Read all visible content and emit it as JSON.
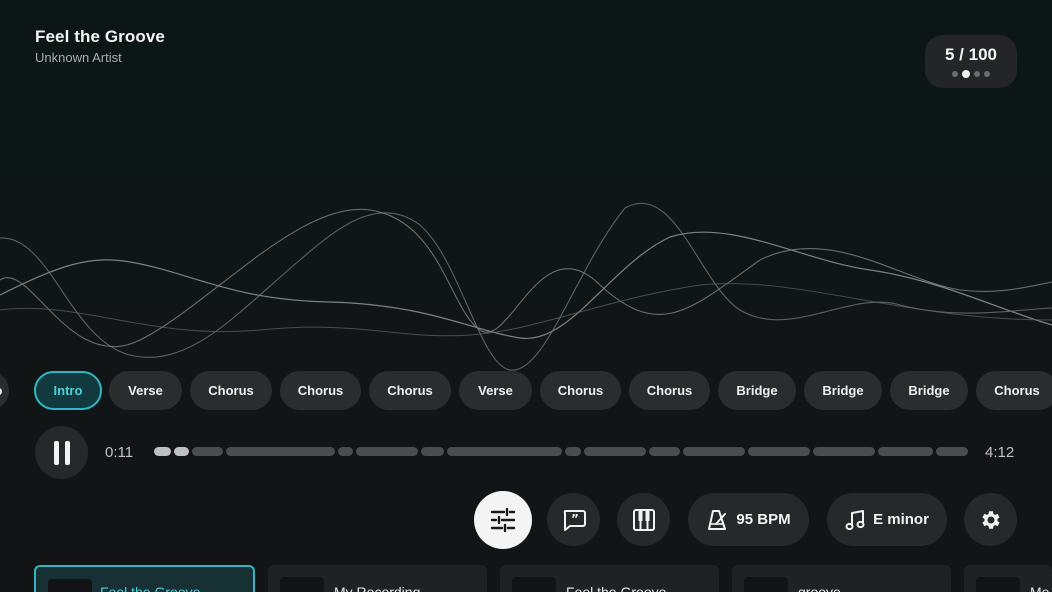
{
  "song": {
    "title": "Feel the Groove",
    "artist": "Unknown Artist"
  },
  "counter": {
    "text": "5 / 100",
    "dots": 4,
    "active_dot": 1
  },
  "sections": [
    {
      "label": "o"
    },
    {
      "label": "Intro",
      "active": true
    },
    {
      "label": "Verse"
    },
    {
      "label": "Chorus"
    },
    {
      "label": "Chorus"
    },
    {
      "label": "Chorus"
    },
    {
      "label": "Verse"
    },
    {
      "label": "Chorus"
    },
    {
      "label": "Chorus"
    },
    {
      "label": "Bridge"
    },
    {
      "label": "Bridge"
    },
    {
      "label": "Bridge"
    },
    {
      "label": "Chorus"
    }
  ],
  "playback": {
    "current_time": "0:11",
    "total_time": "4:12",
    "state": "playing"
  },
  "controls": {
    "mixer_icon": "sliders-icon",
    "lyrics_icon": "lyrics-quote-icon",
    "keyboard_icon": "piano-keys-icon",
    "tempo": {
      "icon": "metronome-icon",
      "label": "95 BPM"
    },
    "key": {
      "icon": "music-note-icon",
      "label": "E minor"
    },
    "settings_icon": "gear-icon"
  },
  "library": [
    {
      "title": "Feel the Groove",
      "active": true
    },
    {
      "title": "My Recording"
    },
    {
      "title": "Feel the Groove"
    },
    {
      "title": "groove"
    },
    {
      "title": "Me"
    }
  ],
  "colors": {
    "accent": "#31b7c4",
    "chip": "#2a2c2e",
    "background": "#121315"
  }
}
